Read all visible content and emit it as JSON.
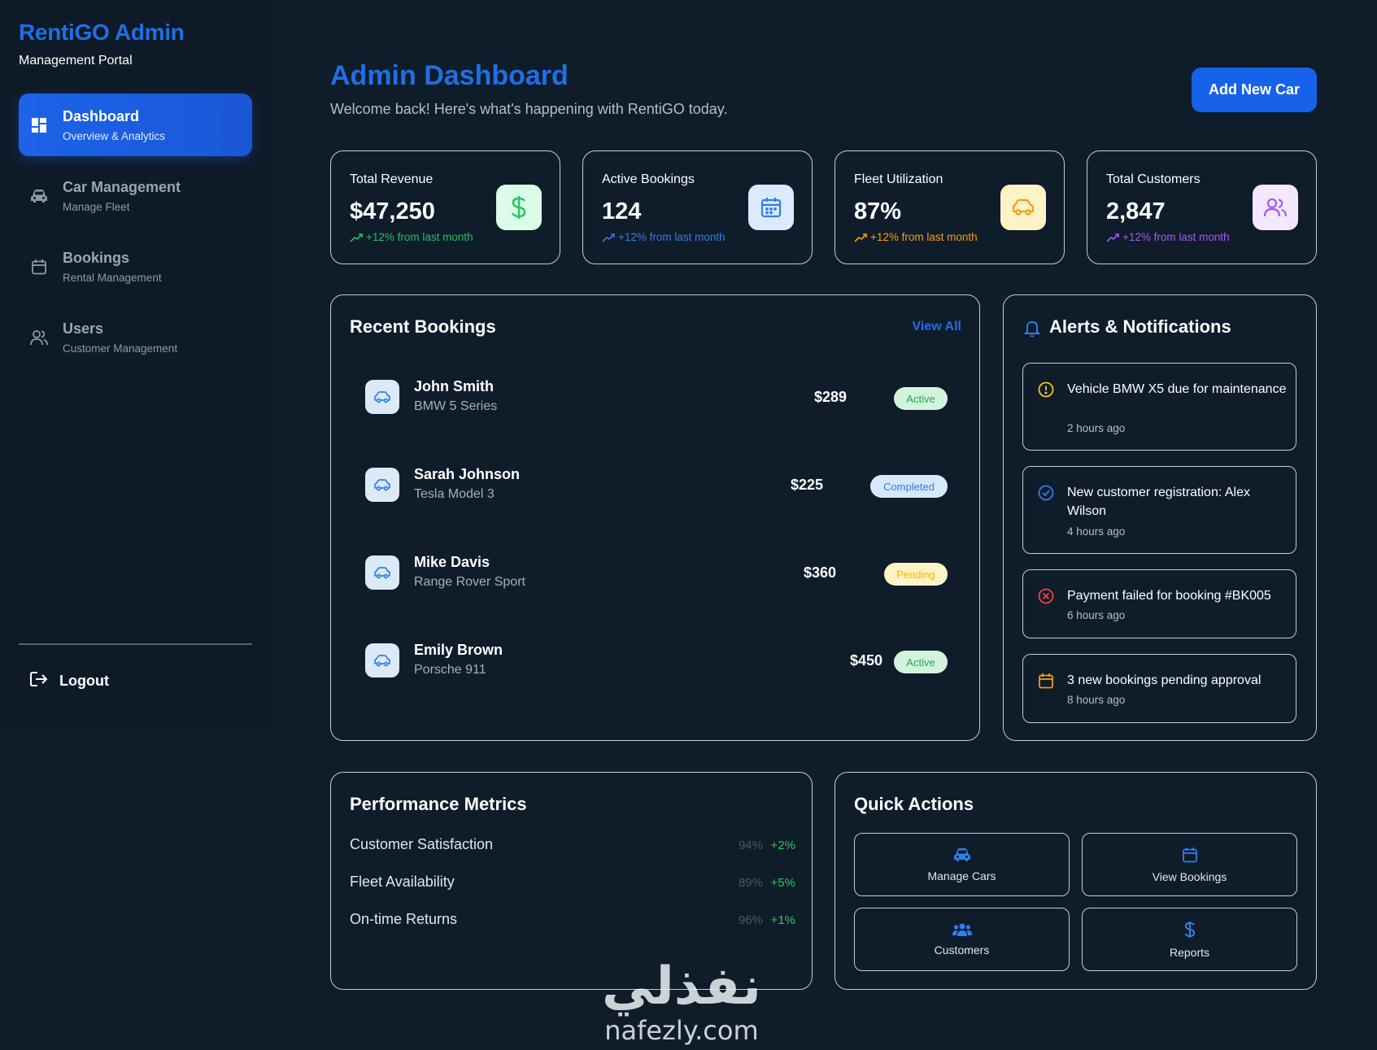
{
  "sidebar": {
    "brand_title": "RentiGO Admin",
    "brand_subtitle": "Management Portal",
    "items": [
      {
        "label": "Dashboard",
        "sub": "Overview & Analytics",
        "icon": "grid-icon",
        "active": true
      },
      {
        "label": "Car Management",
        "sub": "Manage Fleet",
        "icon": "car-icon",
        "active": false
      },
      {
        "label": "Bookings",
        "sub": "Rental Management",
        "icon": "calendar-icon",
        "active": false
      },
      {
        "label": "Users",
        "sub": "Customer Management",
        "icon": "users-icon",
        "active": false
      }
    ],
    "logout_label": "Logout"
  },
  "header": {
    "title": "Admin Dashboard",
    "subtitle": "Welcome back! Here's what's happening with RentiGO today.",
    "add_button": "Add New Car"
  },
  "stats": [
    {
      "label": "Total Revenue",
      "value": "$47,250",
      "trend": "+12% from last month",
      "icon": "dollar-icon",
      "color": "#22c55e",
      "bg": "#dcfce7"
    },
    {
      "label": "Active Bookings",
      "value": "124",
      "trend": "+12% from last month",
      "icon": "calendar-icon",
      "color": "#2f7fea",
      "bg": "#dbeafe"
    },
    {
      "label": "Fleet Utilization",
      "value": "87%",
      "trend": "+12% from last month",
      "icon": "car-icon",
      "color": "#f59e0b",
      "bg": "#fef3c7"
    },
    {
      "label": "Total Customers",
      "value": "2,847",
      "trend": "+12% from last month",
      "icon": "users-icon",
      "color": "#a855f7",
      "bg": "#f3e8ff"
    }
  ],
  "bookings": {
    "title": "Recent Bookings",
    "view_all": "View All",
    "rows": [
      {
        "name": "John Smith",
        "car": "BMW 5 Series",
        "amount": "$289",
        "status": "Active"
      },
      {
        "name": "Sarah Johnson",
        "car": "Tesla Model 3",
        "amount": "$225",
        "status": "Completed"
      },
      {
        "name": "Mike Davis",
        "car": "Range Rover Sport",
        "amount": "$360",
        "status": "Pending"
      },
      {
        "name": "Emily Brown",
        "car": "Porsche 911",
        "amount": "$450",
        "status": "Active"
      }
    ]
  },
  "alerts": {
    "title": "Alerts & Notifications",
    "items": [
      {
        "text": "Vehicle BMW X5 due for maintenance",
        "time": "2 hours ago",
        "icon": "warning-icon"
      },
      {
        "text": "New customer registration: Alex Wilson",
        "time": "4 hours ago",
        "icon": "check-circle-icon"
      },
      {
        "text": "Payment failed for booking #BK005",
        "time": "6 hours ago",
        "icon": "error-circle-icon"
      },
      {
        "text": "3 new bookings pending approval",
        "time": "8 hours ago",
        "icon": "calendar-icon"
      }
    ]
  },
  "metrics": {
    "title": "Performance Metrics",
    "rows": [
      {
        "label": "Customer Satisfaction",
        "value": "94%",
        "delta": "+2%"
      },
      {
        "label": "Fleet Availability",
        "value": "89%",
        "delta": "+5%"
      },
      {
        "label": "On-time Returns",
        "value": "96%",
        "delta": "+1%"
      }
    ]
  },
  "quick_actions": {
    "title": "Quick Actions",
    "items": [
      {
        "label": "Manage Cars",
        "icon": "car-icon"
      },
      {
        "label": "View Bookings",
        "icon": "calendar-icon"
      },
      {
        "label": "Customers",
        "icon": "users-icon"
      },
      {
        "label": "Reports",
        "icon": "dollar-icon"
      }
    ]
  },
  "watermark": {
    "arabic": "نفذلي",
    "latin": "nafezly.com"
  }
}
